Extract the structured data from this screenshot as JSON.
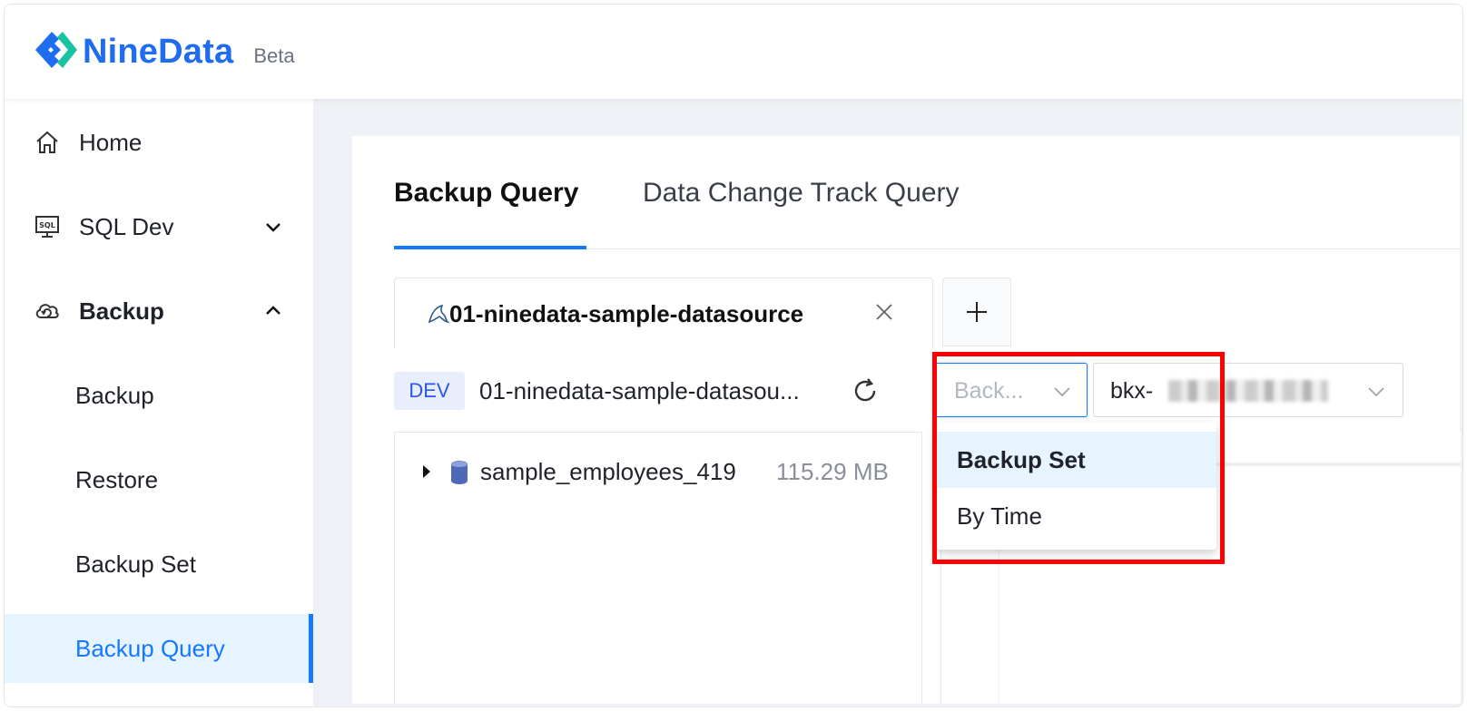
{
  "brand": {
    "name": "NineData",
    "badge": "Beta",
    "color": "#1e6cf0"
  },
  "sidebar": {
    "items": [
      {
        "label": "Home",
        "icon": "home-icon"
      },
      {
        "label": "SQL Dev",
        "icon": "sql-monitor-icon",
        "expanded": false
      },
      {
        "label": "Backup",
        "icon": "cloud-backup-icon",
        "expanded": true
      },
      {
        "label": "Backup"
      },
      {
        "label": "Restore"
      },
      {
        "label": "Backup Set"
      },
      {
        "label": "Backup Query",
        "active": true
      }
    ]
  },
  "tabs": [
    {
      "label": "Backup Query",
      "active": true
    },
    {
      "label": "Data Change Track Query",
      "active": false
    }
  ],
  "datasource_tab": {
    "name": "01-ninedata-sample-datasource",
    "icon": "mysql-dolphin-icon"
  },
  "toolbar": {
    "env": "DEV",
    "datasource": "01-ninedata-sample-datasou...",
    "mode_placeholder": "Back...",
    "backup_set_value": "bkx-"
  },
  "tree": [
    {
      "name": "sample_employees_419",
      "size": "115.29 MB"
    }
  ],
  "dropdown": {
    "options": [
      {
        "label": "Backup Set",
        "selected": true
      },
      {
        "label": "By Time",
        "selected": false
      }
    ]
  },
  "colors": {
    "accent": "#1677ff",
    "highlight": "#ff0000",
    "env_badge_bg": "#e8eefc"
  }
}
